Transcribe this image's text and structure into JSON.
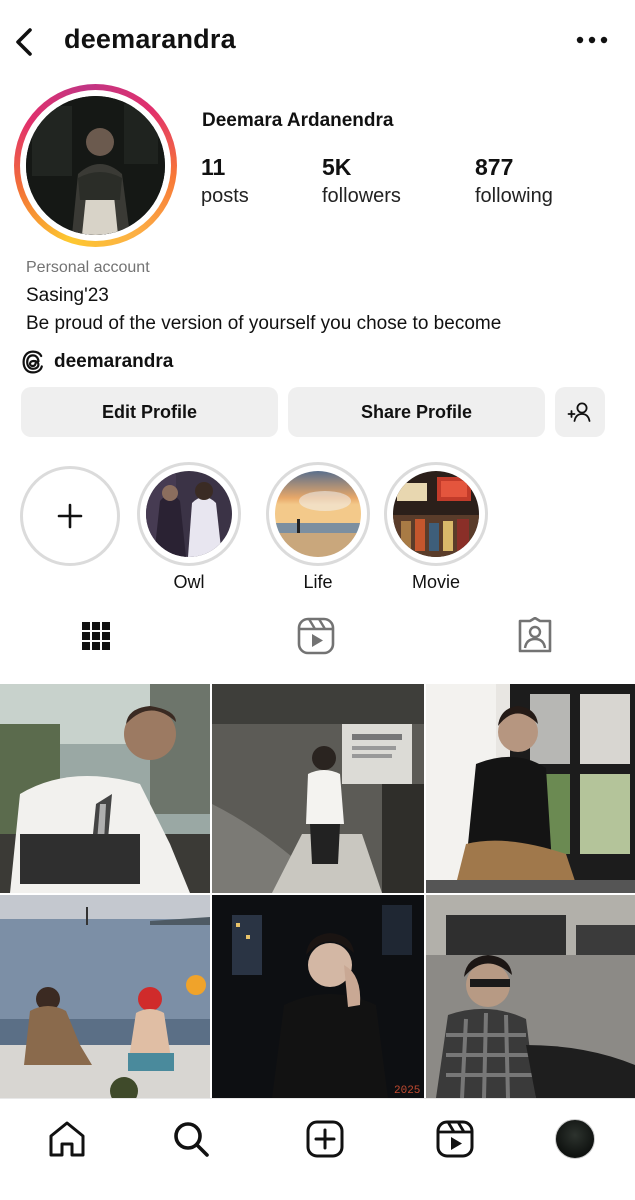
{
  "header": {
    "username": "deemarandra",
    "back_icon": "chevron-left-icon",
    "more_icon": "more-horizontal-icon"
  },
  "profile": {
    "display_name": "Deemara Ardanendra",
    "stats": [
      {
        "value": "11",
        "label": "posts"
      },
      {
        "value": "5K",
        "label": "followers"
      },
      {
        "value": "877",
        "label": "following"
      }
    ],
    "account_type": "Personal account",
    "bio": [
      "Sasing'23",
      "Be proud of the version of yourself you chose to become"
    ],
    "threads_handle": "deemarandra",
    "threads_icon": "threads-icon"
  },
  "buttons": {
    "edit": "Edit Profile",
    "share": "Share Profile",
    "add_friend_icon": "add-person-icon"
  },
  "highlights": [
    {
      "label": "",
      "type": "new",
      "icon": "plus-icon"
    },
    {
      "label": "Owl"
    },
    {
      "label": "Life"
    },
    {
      "label": "Movie"
    }
  ],
  "tabs": [
    {
      "name": "posts-grid",
      "icon": "grid-icon",
      "active": true
    },
    {
      "name": "reels",
      "icon": "reels-icon",
      "active": false
    },
    {
      "name": "tagged",
      "icon": "tagged-person-icon",
      "active": false
    }
  ],
  "posts": [
    {
      "description": "man in white shirt and checkered tie sitting outdoors"
    },
    {
      "description": "man standing in stairwell"
    },
    {
      "description": "man in black shirt sitting by window"
    },
    {
      "description": "people on boat looking at sea"
    },
    {
      "description": "man in black shirt at night city"
    },
    {
      "description": "man in plaid shirt with sunglasses"
    }
  ],
  "post_stamp": "2025",
  "bottom_nav": [
    {
      "name": "home",
      "icon": "home-icon"
    },
    {
      "name": "search",
      "icon": "search-icon"
    },
    {
      "name": "create",
      "icon": "add-square-icon"
    },
    {
      "name": "reels",
      "icon": "reels-icon"
    },
    {
      "name": "profile",
      "icon": "avatar"
    }
  ],
  "colors": {
    "button_bg": "#efefef",
    "secondary_text": "#737373",
    "story_ring": [
      "#fdc830",
      "#f37335",
      "#e1306c",
      "#c13584"
    ]
  }
}
